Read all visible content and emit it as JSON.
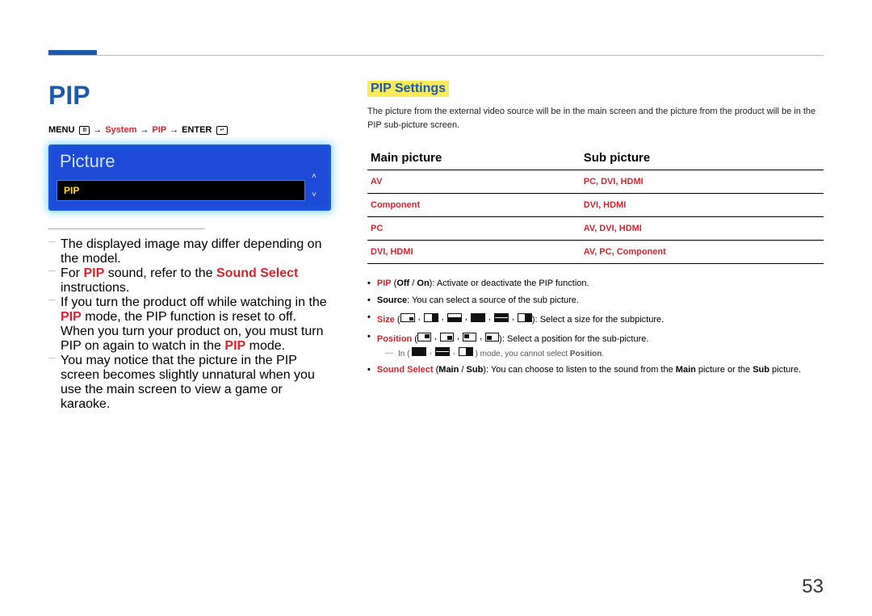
{
  "page_number": "53",
  "left": {
    "title": "PIP",
    "breadcrumb": {
      "menu": "MENU",
      "system": "System",
      "pip": "PIP",
      "enter": "ENTER"
    },
    "menu_panel": {
      "heading": "Picture",
      "selected": "PIP"
    },
    "notes": {
      "n1": "The displayed image may differ depending on the model.",
      "n2_a": "For ",
      "n2_b": "PIP",
      "n2_c": " sound, refer to the ",
      "n2_d": "Sound Select",
      "n2_e": " instructions.",
      "n3_a": "If you turn the product off while watching in the ",
      "n3_b": "PIP",
      "n3_c": " mode, the PIP function is reset to off. When you turn your product on, you must turn PIP on again to watch in the ",
      "n3_d": "PIP",
      "n3_e": " mode.",
      "n4": "You may notice that the picture in the PIP screen becomes slightly unnatural when you use the main screen to view a game or karaoke."
    }
  },
  "right": {
    "heading": "PIP Settings",
    "intro": "The picture from the external video source will be in the main screen and the picture from the product will be in the PIP sub-picture screen.",
    "table": {
      "col1": "Main picture",
      "col2": "Sub picture",
      "rows": [
        {
          "main": "AV",
          "sub": "PC, DVI, HDMI"
        },
        {
          "main": "Component",
          "sub": "DVI, HDMI"
        },
        {
          "main": "PC",
          "sub": "AV, DVI, HDMI"
        },
        {
          "main": "DVI, HDMI",
          "sub": "AV, PC, Component"
        }
      ]
    },
    "bullets": {
      "b1_a": "PIP",
      "b1_b": "Off",
      "b1_c": "On",
      "b1_d": "): Activate or deactivate the PIP function.",
      "b2_a": "Source",
      "b2_b": ": You can select a source of the sub picture.",
      "b3_a": "Size",
      "b3_b": "): Select a size for the subpicture.",
      "b4_a": "Position",
      "b4_b": "): Select a position for the sub-picture.",
      "b4_note_a": "In (",
      "b4_note_b": ") mode, you cannot select ",
      "b4_note_c": "Position",
      "b5_a": "Sound Select",
      "b5_b": "Main",
      "b5_c": "Sub",
      "b5_d": "): You can choose to listen to the sound from the ",
      "b5_e": "Main",
      "b5_f": " picture or the ",
      "b5_g": "Sub",
      "b5_h": " picture."
    }
  }
}
